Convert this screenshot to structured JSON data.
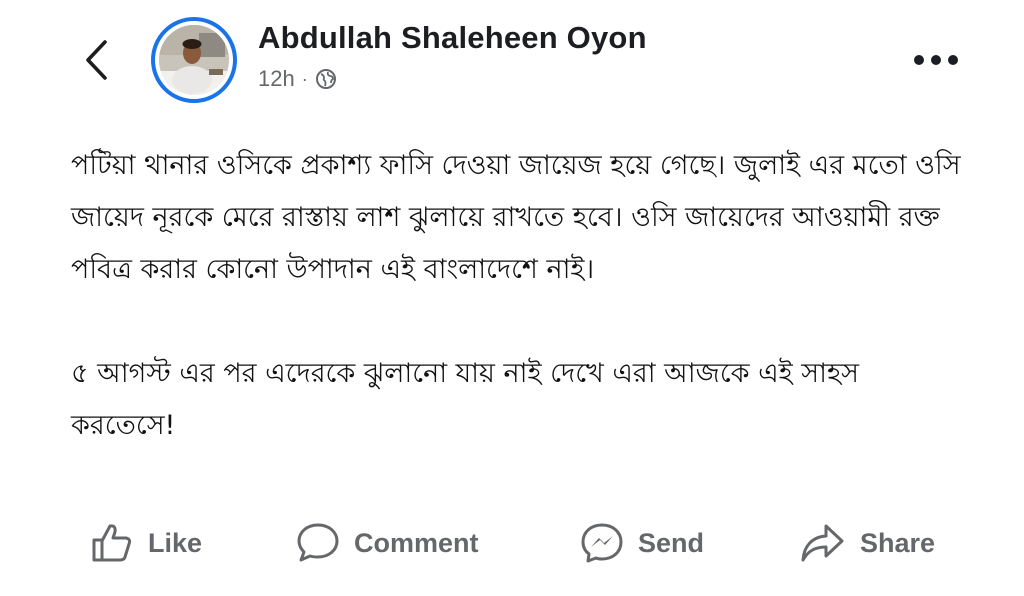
{
  "post": {
    "author_name": "Abdullah Shaleheen Oyon",
    "timestamp": "12h",
    "separator": "·",
    "audience_icon": "globe-icon",
    "paragraphs": [
      "পটিয়া থানার ওসিকে প্রকাশ্য ফাসি দেওয়া জায়েজ হয়ে গেছে। জুলাই এর মতো ওসি জায়েদ নূরকে মেরে রাস্তায় লাশ ঝুলায়ে রাখতে হবে। ওসি জায়েদের আওয়ামী রক্ত পবিত্র করার কোনো উপাদান এই বাংলাদেশে নাই।",
      "৫ আগস্ট এর পর এদেরকে ঝুলানো যায় নাই দেখে এরা আজকে এই সাহস করতেসে!"
    ]
  },
  "actions": {
    "like_label": "Like",
    "comment_label": "Comment",
    "send_label": "Send",
    "share_label": "Share"
  },
  "colors": {
    "avatar_ring": "#1a73e8",
    "action_text": "#65676b",
    "name_text": "#1c1e21"
  }
}
